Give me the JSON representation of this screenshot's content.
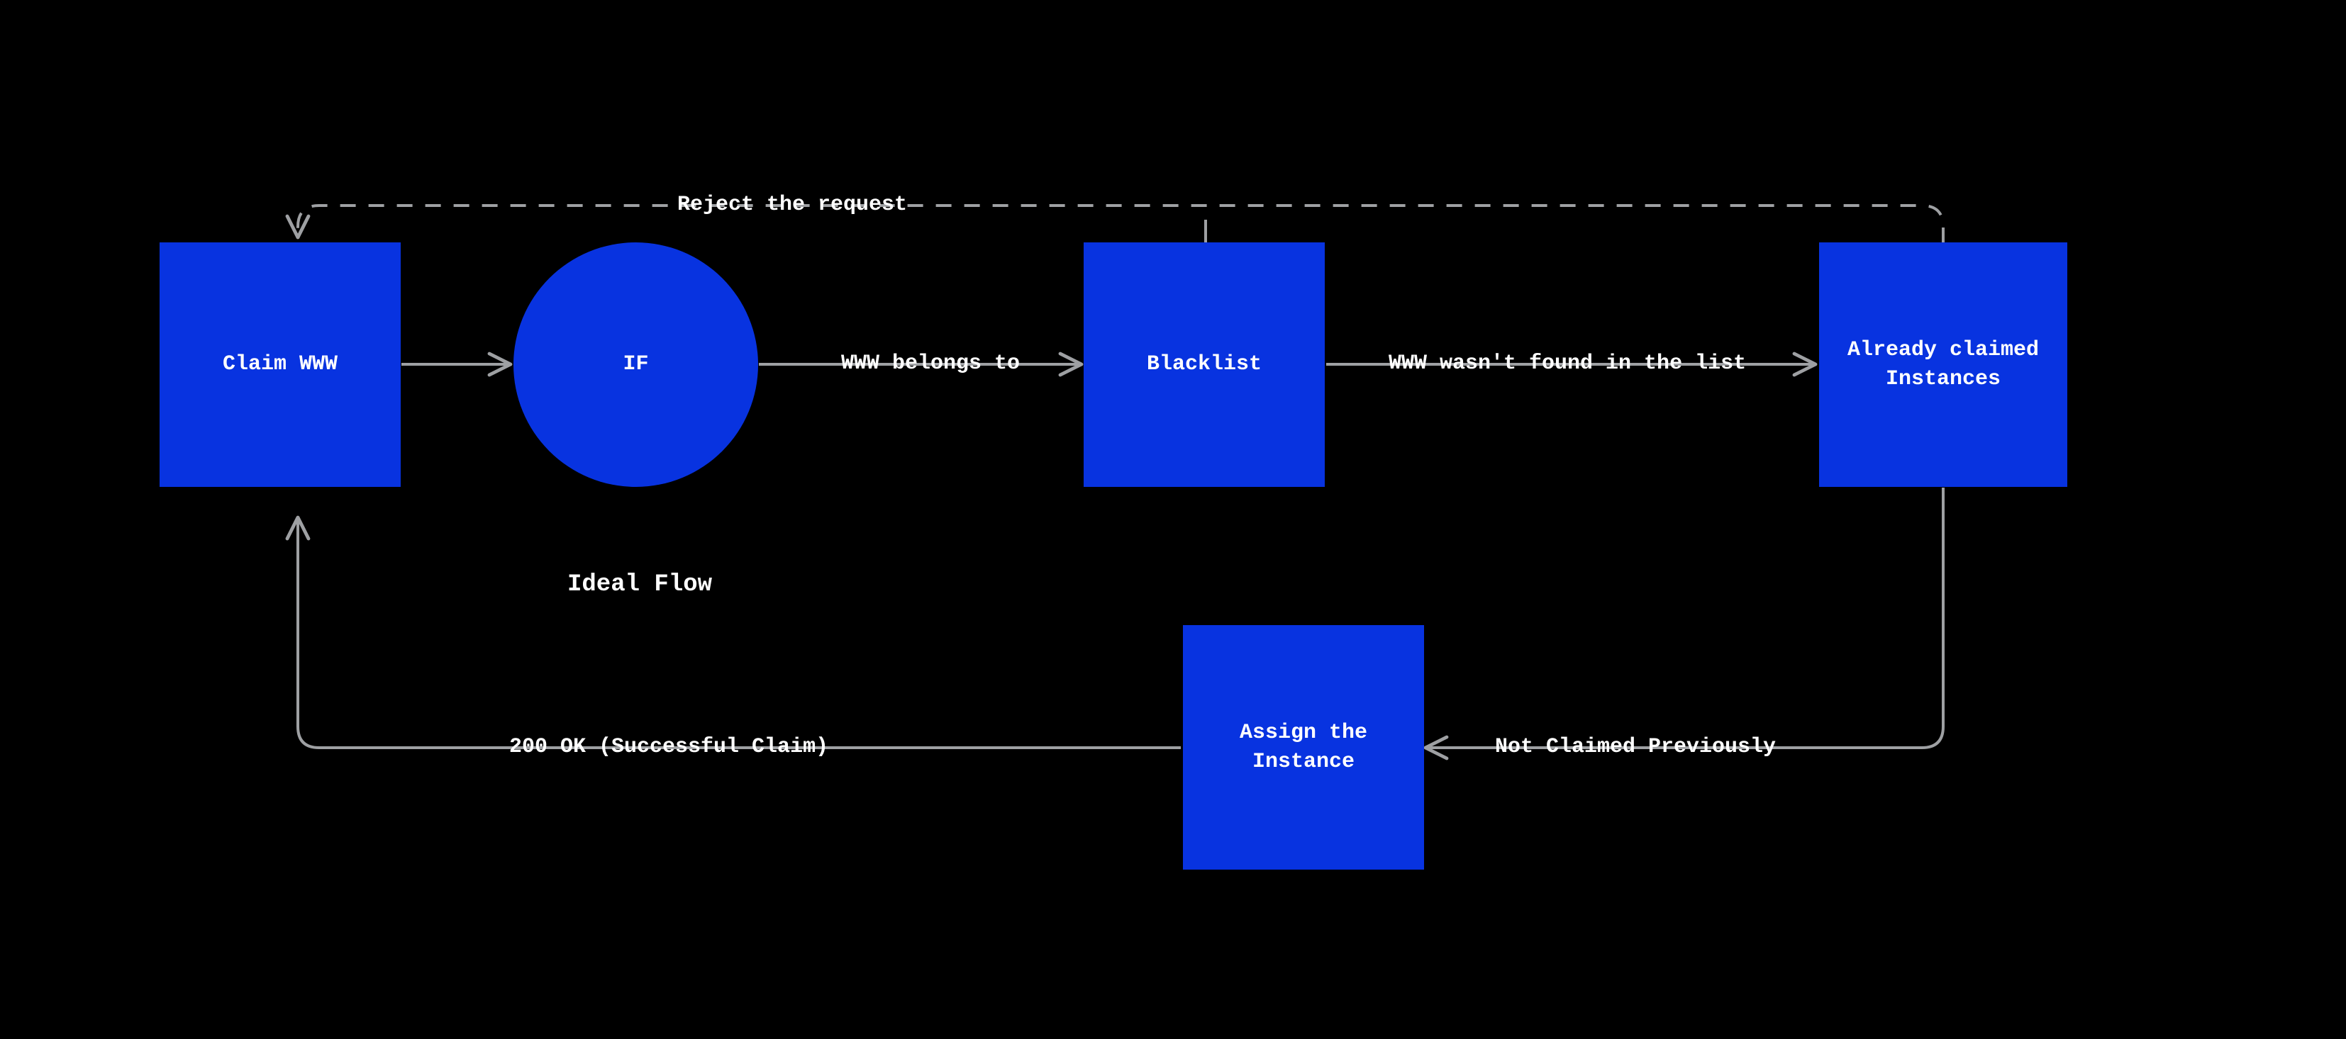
{
  "title": "Ideal Flow",
  "nodes": {
    "claim": {
      "label": "Claim WWW"
    },
    "if": {
      "label": "IF"
    },
    "black": {
      "label": "Blacklist"
    },
    "already": {
      "label": "Already claimed\nInstances"
    },
    "assign": {
      "label": "Assign the\nInstance"
    }
  },
  "edges": {
    "reject": "Reject the request",
    "belongs": "WWW belongs to",
    "notfound": "WWW wasn't found in the list",
    "notclaimed": "Not Claimed Previously",
    "ok": "200 OK (Successful Claim)"
  },
  "colors": {
    "node": "#0833E0",
    "bg": "#000000",
    "line": "#9ea0a3",
    "text": "#ffffff"
  }
}
